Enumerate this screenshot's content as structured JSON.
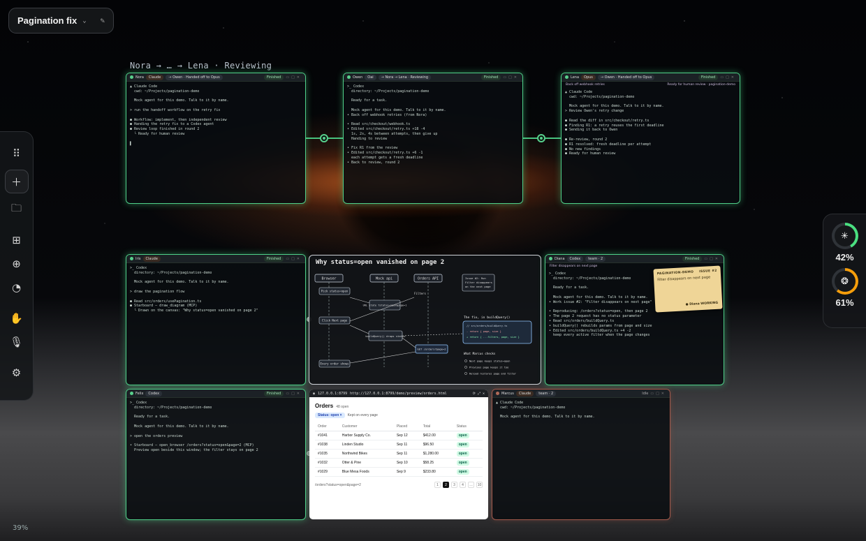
{
  "workspace": {
    "title": "Pagination fix",
    "breadcrumb": "Nora → … → Lena · Reviewing",
    "zoom": "39%"
  },
  "usage": [
    {
      "name": "claude-usage",
      "percent": "42%",
      "fraction": 0.42,
      "color": "#4ade80"
    },
    {
      "name": "openai-usage",
      "percent": "61%",
      "fraction": 0.61,
      "color": "#f59e0b"
    }
  ],
  "windows": {
    "nora": {
      "user": "Nora",
      "agent": "Claude",
      "handoff": "→ Owen · Handed off to Opus",
      "status": "Finished",
      "body": "▲ Claude Code\n  cwd: ~/Projects/pagination-demo\n\n  Mock agent for this demo. Talk to it by name.\n\n> run the handoff workflow on the retry fix\n\n● Workflow: implement, then independent review\n● Handing the retry fix to a Codex agent\n● Review loop finished in round 2\n  └ Ready for human review\n\n▌"
    },
    "owen": {
      "user": "Owen",
      "agent": "Oai",
      "handoff": "→ Nora → Lena · Reviewing",
      "status": "Finished",
      "body": ">_ Codex\n  directory: ~/Projects/pagination-demo\n\n  Ready for a task.\n\n  Mock agent for this demo. Talk to it by name.\n• Back off webhook retries (from Nora)\n\n• Read src/checkout/webhook.ts\n• Edited src/checkout/retry.ts +18 -4\n  1s, 2s, 4s between attempts, then give up\n  Handing to review\n\n• Fix R1 from the review\n• Edited src/checkout/retry.ts +6 -1\n  each attempt gets a fresh deadline\n• Back to review, round 2"
    },
    "lena": {
      "user": "Lena",
      "agent": "Opus",
      "handoff": "→ Owen · Handed off to Opus",
      "status": "Finished",
      "subtitle_left": "Back off webhook retries",
      "subtitle_right": "Ready for human review · pagination-demo",
      "body": "▲ Claude Code\n  cwd: ~/Projects/pagination-demo\n\n  Mock agent for this demo. Talk to it by name.\n> Review Owen's retry change\n\n● Read the diff in src/checkout/retry.ts\n● Finding R1: a retry reuses the first deadline\n● Sending it back to Owen\n\n● Re-review, round 2\n● R1 resolved: fresh deadline per attempt\n● No new findings\n● Ready for human review"
    },
    "iris": {
      "user": "Iris",
      "agent": "Claude",
      "status": "Finished",
      "body": ">_ Codex\n  directory: ~/Projects/pagination-demo\n\n  Mock agent for this demo. Talk to it by name.\n\n> draw the pagination flow\n\n● Read src/orders/usePagination.ts\n● Starboard – draw_diagram (MCP)\n  └ Drawn on the canvas: \"Why status=open vanished on page 2\""
    },
    "diana": {
      "user": "Diana",
      "agent": "Codex",
      "extra": "team · 2",
      "status": "Finished",
      "subtitle_left": "Filter disappears on next page",
      "body": ">_ Codex\n  directory: ~/Projects/pagination-demo\n\n  Ready for a task.\n\n  Mock agent for this demo. Talk to it by name.\n• Work issue #2: \"Filter disappears on next page\"\n\n• Reproducing: /orders?status=open, then page 2\n• The page 2 request has no status parameter\n• Read src/orders/buildQuery.ts\n• buildQuery() rebuilds params from page and size\n• Edited src/orders/buildQuery.ts +4 -2\n  keep every active filter when the page changes"
    },
    "felix": {
      "user": "Felix",
      "agent": "Codex",
      "status": "Finished",
      "body": ">_ Codex\n  directory: ~/Projects/pagination-demo\n\n  Ready for a task.\n\n  Mock agent for this demo. Talk to it by name.\n\n> open the orders preview\n\n• Starboard – open_browser /orders?status=open&page=2 (MCP)\n  Preview open beside this window; the filter stays on page 2"
    },
    "marcus": {
      "user": "Marcus",
      "agent": "Claude",
      "extra": "team · 2",
      "status": "Idle",
      "body": "▲ Claude Code\n  cwd: ~/Projects/pagination-demo\n\n  Mock agent for this demo. Talk to it by name."
    }
  },
  "diagram": {
    "title": "Why status=open vanished on page 2",
    "lanes": [
      "Browser",
      "Mock api",
      "Orders API"
    ],
    "steps": [
      "Pick status=open",
      "URL state ?status=open&page=1",
      "Click Next page",
      "buildQuery() drops status",
      "GET /orders?page=2",
      "Every order shows"
    ],
    "issue": "Issue #2: Run\nFilter disappears\non the next page",
    "fix_title": "The fix, in buildQuery()",
    "fix_code": [
      "// src/orders/buildQuery.ts",
      "- return { page, size }",
      "+ return { ...filters, page, size }"
    ],
    "checks_title": "What Marcus checks",
    "checks": [
      "Next page keeps status=open",
      "Previous page keeps it too",
      "Reload restores page and filter"
    ],
    "filters_label": "Filters"
  },
  "browser": {
    "address": "127.0.0.1:8799",
    "url": "http://127.0.0.1:8799/demo/preview/orders.html",
    "heading": "Orders",
    "count": "48 open",
    "filter_tag": "Status: open ×",
    "filter_note": "Kept on every page",
    "columns": [
      "Order",
      "Customer",
      "Placed",
      "Total",
      "Status"
    ],
    "rows": [
      [
        "#1041",
        "Harbor Supply Co.",
        "Sep 12",
        "$412.00",
        "open"
      ],
      [
        "#1038",
        "Linden Studio",
        "Sep 11",
        "$96.50",
        "open"
      ],
      [
        "#1035",
        "Northwind Bikes",
        "Sep 11",
        "$1,280.00",
        "open"
      ],
      [
        "#1032",
        "Otter & Pine",
        "Sep 10",
        "$58.25",
        "open"
      ],
      [
        "#1029",
        "Blue Mesa Foods",
        "Sep 9",
        "$233.80",
        "open"
      ]
    ],
    "path": "/orders?status=open&page=2",
    "pages": [
      "1",
      "2",
      "3",
      "4",
      "…",
      "10"
    ]
  },
  "note": {
    "header": "PAGINATION-DEMO",
    "issue": "ISSUE #2",
    "text": "Filter disappears on next page",
    "footer": "● Diana WORKING"
  },
  "colors": {
    "accent": "#4fd089",
    "idle_border": "#a35a4c",
    "note": "#efd597"
  }
}
